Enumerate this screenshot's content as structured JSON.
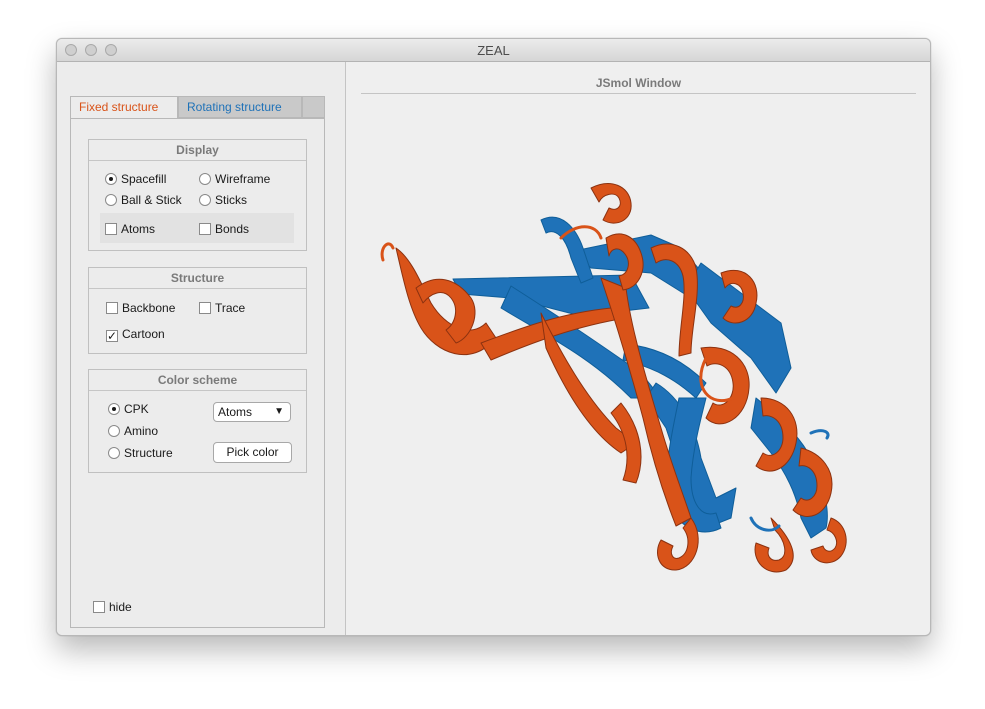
{
  "window": {
    "title": "ZEAL"
  },
  "tabs": {
    "fixed": "Fixed structure",
    "rotating": "Rotating structure"
  },
  "display": {
    "title": "Display",
    "spacefill": "Spacefill",
    "wireframe": "Wireframe",
    "ball_stick": "Ball & Stick",
    "sticks": "Sticks",
    "atoms": "Atoms",
    "bonds": "Bonds",
    "selected": "Spacefill"
  },
  "structure": {
    "title": "Structure",
    "backbone": "Backbone",
    "trace": "Trace",
    "cartoon": "Cartoon",
    "cartoon_checked": true
  },
  "color_scheme": {
    "title": "Color scheme",
    "cpk": "CPK",
    "amino": "Amino",
    "structure": "Structure",
    "selected": "CPK",
    "dropdown_value": "Atoms",
    "pick_color": "Pick color"
  },
  "hide_label": "hide",
  "jsmol": {
    "title": "JSmol Window"
  },
  "colors": {
    "fixed": "#d95319",
    "rotating": "#1f72b8"
  }
}
